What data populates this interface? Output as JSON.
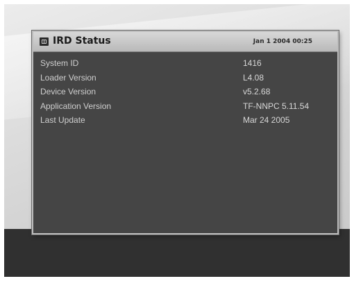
{
  "window": {
    "title": "IRD Status",
    "datetime": "Jan 1 2004 00:25",
    "icon": "info-box-icon"
  },
  "status_rows": [
    {
      "label": "System ID",
      "value": "1416"
    },
    {
      "label": "Loader Version",
      "value": "L4.08"
    },
    {
      "label": "Device Version",
      "value": "v5.2.68"
    },
    {
      "label": "Application Version",
      "value": "TF-NNPC 5.11.54"
    },
    {
      "label": "Last Update",
      "value": "Mar 24 2005"
    }
  ]
}
